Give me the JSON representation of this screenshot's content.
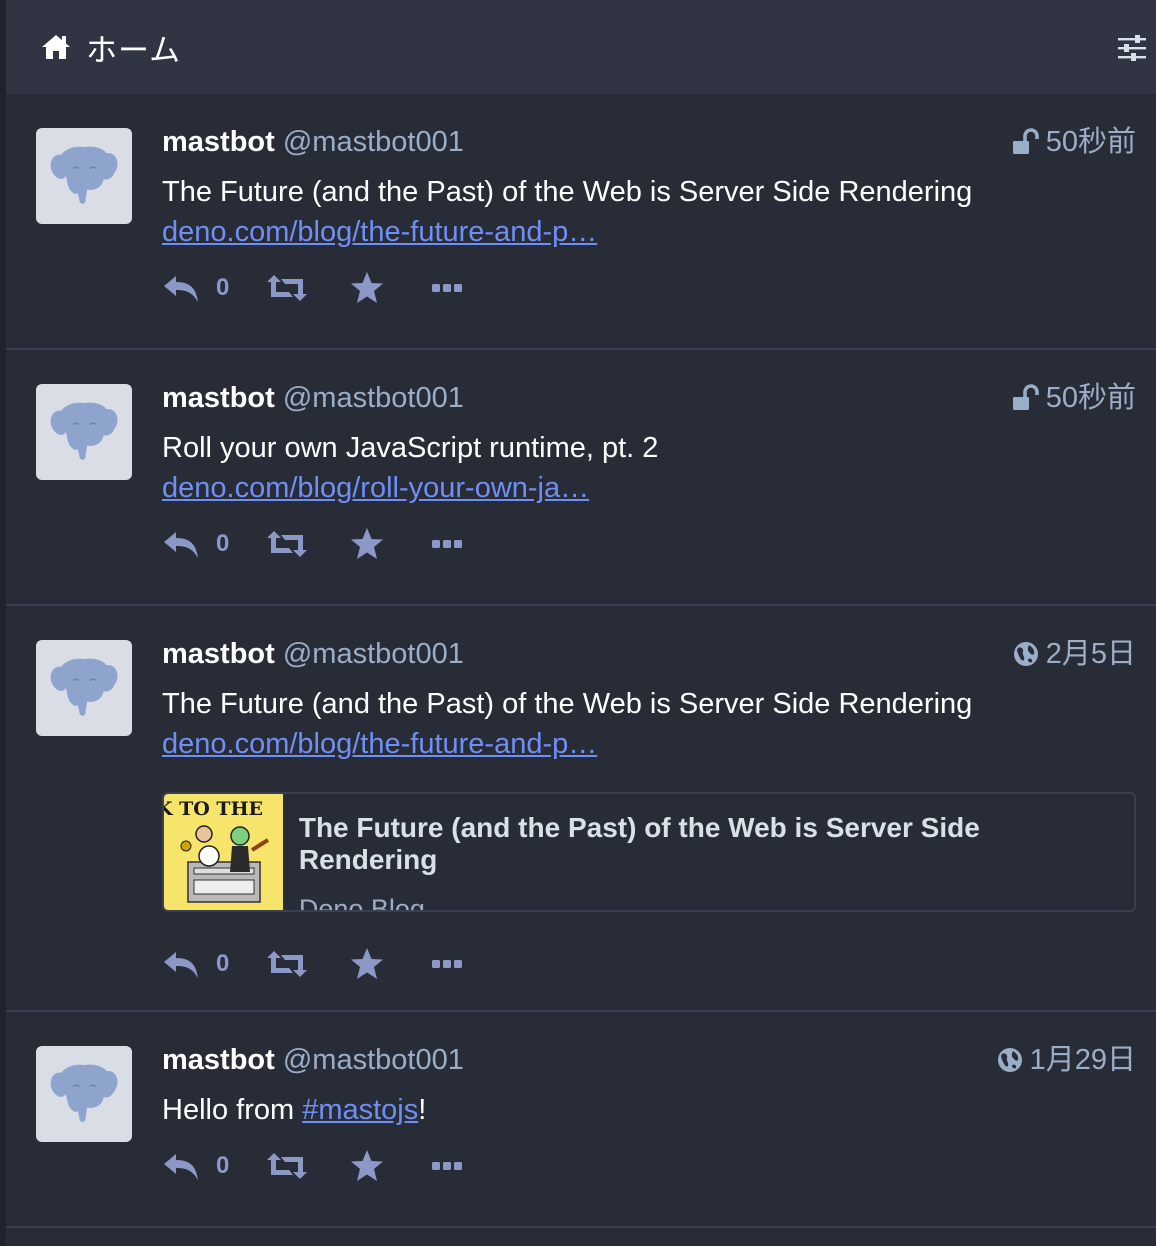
{
  "header": {
    "title": "ホーム",
    "home_icon": "home-icon",
    "settings_icon": "sliders-icon"
  },
  "colors": {
    "background": "#282c37",
    "header": "#313543",
    "link": "#6f8ff5",
    "muted": "#9baec8",
    "action": "#8c99c6"
  },
  "statuses": [
    {
      "display_name": "mastbot",
      "acct": "@mastbot001",
      "visibility_icon": "unlock-icon",
      "time": "50秒前",
      "text": "The Future (and the Past) of the Web is Server Side Rendering",
      "link": "deno.com/blog/the-future-and-p…",
      "reply_count": "0"
    },
    {
      "display_name": "mastbot",
      "acct": "@mastbot001",
      "visibility_icon": "unlock-icon",
      "time": "50秒前",
      "text": "Roll your own JavaScript runtime, pt. 2",
      "link": "deno.com/blog/roll-your-own-ja…",
      "reply_count": "0"
    },
    {
      "display_name": "mastbot",
      "acct": "@mastbot001",
      "visibility_icon": "globe-icon",
      "time": "2月5日",
      "text": "The Future (and the Past) of the Web is Server Side Rendering",
      "link": "deno.com/blog/the-future-and-p…",
      "reply_count": "0",
      "card": {
        "thumb_text": "K TO THE",
        "title": "The Future (and the Past) of the Web is Server Side Rendering",
        "provider": "Deno Blog"
      }
    },
    {
      "display_name": "mastbot",
      "acct": "@mastbot001",
      "visibility_icon": "globe-icon",
      "time": "1月29日",
      "text_prefix": "Hello from ",
      "hashtag": "#mastojs",
      "text_suffix": "!",
      "reply_count": "0"
    }
  ]
}
